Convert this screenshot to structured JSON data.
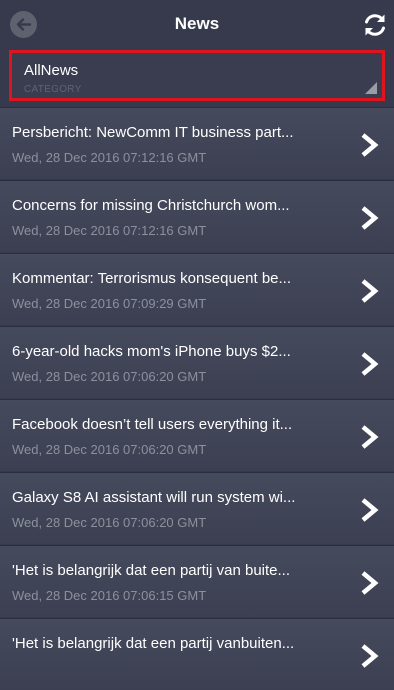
{
  "header": {
    "title": "News",
    "back_icon": "arrow-left-icon",
    "refresh_icon": "refresh-icon"
  },
  "category": {
    "value": "AllNews",
    "label": "CATEGORY",
    "highlight_color": "#e0141c"
  },
  "news": [
    {
      "title": "Persbericht: NewComm IT business part...",
      "date": "Wed, 28 Dec 2016 07:12:16 GMT"
    },
    {
      "title": "Concerns for missing Christchurch wom...",
      "date": "Wed, 28 Dec 2016 07:12:16 GMT"
    },
    {
      "title": "Kommentar: Terrorismus konsequent be...",
      "date": "Wed, 28 Dec 2016 07:09:29 GMT"
    },
    {
      "title": "6-year-old hacks mom's iPhone  buys $2...",
      "date": "Wed, 28 Dec 2016 07:06:20 GMT"
    },
    {
      "title": "Facebook doesn’t tell users everything it...",
      "date": "Wed, 28 Dec 2016 07:06:20 GMT"
    },
    {
      "title": "Galaxy S8 AI assistant will run system wi...",
      "date": "Wed, 28 Dec 2016 07:06:20 GMT"
    },
    {
      "title": "'Het is belangrijk dat een partij van buite...",
      "date": "Wed, 28 Dec 2016 07:06:15 GMT"
    },
    {
      "title": "'Het is belangrijk dat een partij vanbuiten...",
      "date": ""
    }
  ]
}
